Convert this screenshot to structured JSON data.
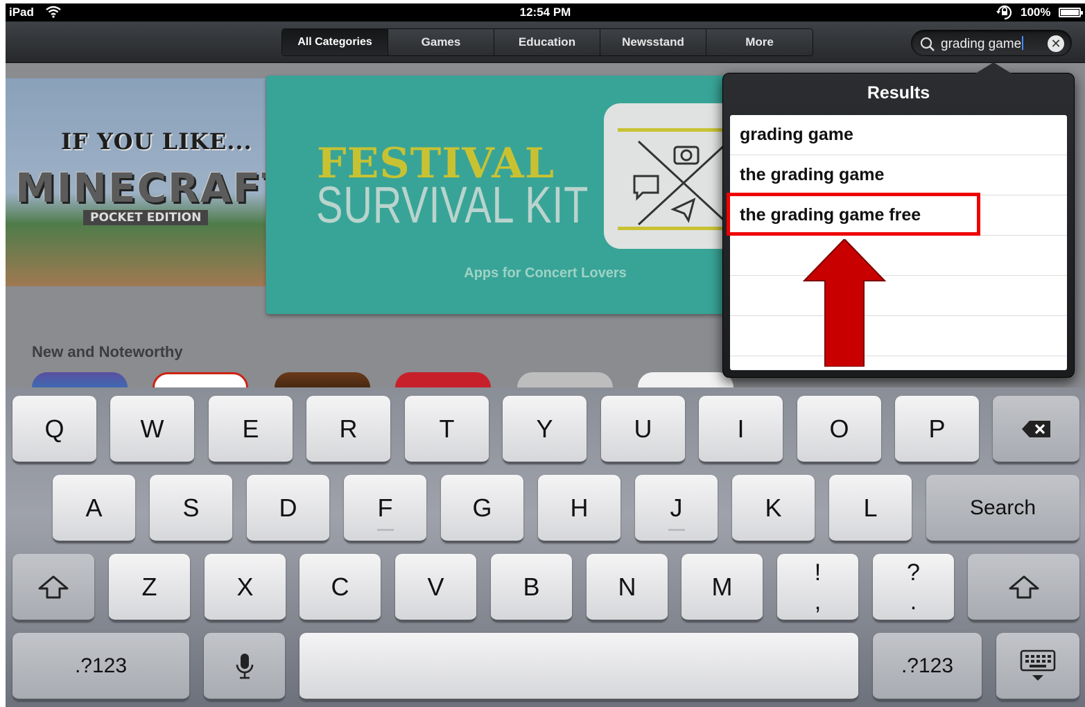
{
  "status": {
    "carrier": "iPad",
    "time": "12:54 PM",
    "battery": "100%"
  },
  "nav": {
    "tabs": [
      {
        "label": "All Categories",
        "active": true
      },
      {
        "label": "Games"
      },
      {
        "label": "Education"
      },
      {
        "label": "Newsstand"
      },
      {
        "label": "More"
      }
    ]
  },
  "search": {
    "query": "grading game"
  },
  "store": {
    "banner1": {
      "line1": "IF YOU LIKE...",
      "line2": "MINECRAFT",
      "line3": "POCKET EDITION"
    },
    "banner2": {
      "line1": "FESTIVAL",
      "line2": "SURVIVAL KIT",
      "caption": "Apps for Concert Lovers"
    },
    "section_title": "New and Noteworthy"
  },
  "results": {
    "title": "Results",
    "items": [
      "grading game",
      "the grading game",
      "the grading game free"
    ],
    "highlighted_item": "the grading game free"
  },
  "keyboard": {
    "row1": [
      "Q",
      "W",
      "E",
      "R",
      "T",
      "Y",
      "U",
      "I",
      "O",
      "P"
    ],
    "row2": [
      "A",
      "S",
      "D",
      "F",
      "G",
      "H",
      "J",
      "K",
      "L"
    ],
    "search_key": "Search",
    "row3": [
      "Z",
      "X",
      "C",
      "V",
      "B",
      "N",
      "M"
    ],
    "punct1": [
      "!",
      ","
    ],
    "punct2": [
      "?",
      "."
    ],
    "numbers_key": ".?123"
  },
  "colors": {
    "highlight": "#ee0000",
    "accent": "#4a8cff"
  }
}
